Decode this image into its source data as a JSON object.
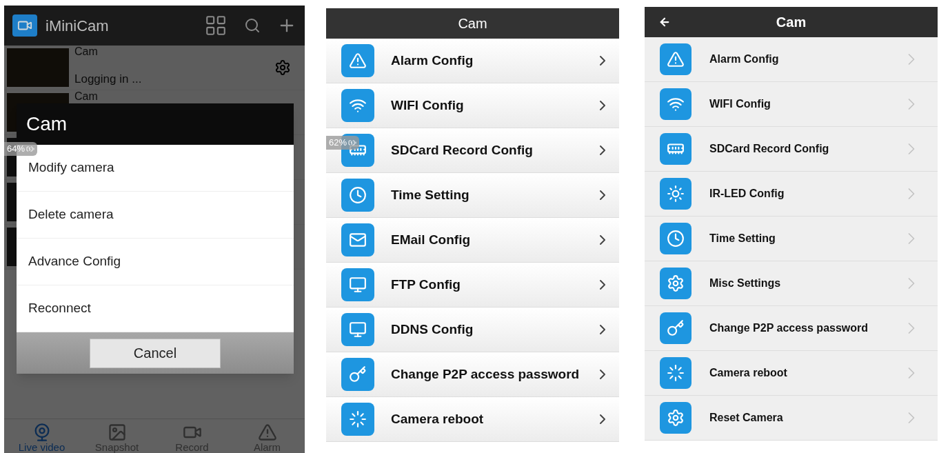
{
  "home_screen": {
    "app_title": "iMiniCam",
    "cameras": [
      {
        "name": "Cam",
        "status": "Logging in ..."
      },
      {
        "name": "Cam"
      },
      {
        "kind": "thumbnail_only"
      },
      {
        "kind": "thumbnail_only"
      },
      {
        "kind": "thumbnail_only"
      }
    ],
    "battery": "64%",
    "dialog": {
      "title": "Cam",
      "options": [
        "Modify camera",
        "Delete camera",
        "Advance Config",
        "Reconnect"
      ],
      "cancel": "Cancel"
    },
    "bottom_nav": [
      {
        "label": "Live video",
        "kind": "live",
        "selected": true
      },
      {
        "label": "Snapshot",
        "kind": "snapshot",
        "selected": false
      },
      {
        "label": "Record",
        "kind": "record",
        "selected": false
      },
      {
        "label": "Alarm",
        "kind": "alarm",
        "selected": false
      }
    ]
  },
  "settings_screen": {
    "title": "Cam",
    "back": false,
    "battery": "62%",
    "items": [
      {
        "label": "Alarm Config",
        "kind": "alarm"
      },
      {
        "label": "WIFI Config",
        "kind": "wifi"
      },
      {
        "label": "SDCard Record Config",
        "kind": "sdcard"
      },
      {
        "label": "Time Setting",
        "kind": "clock"
      },
      {
        "label": "EMail Config",
        "kind": "mail"
      },
      {
        "label": "FTP Config",
        "kind": "ftp"
      },
      {
        "label": "DDNS Config",
        "kind": "ddns"
      },
      {
        "label": "Change P2P access password",
        "kind": "key"
      },
      {
        "label": "Camera reboot",
        "kind": "reboot"
      }
    ]
  },
  "settings_screen_alt": {
    "title": "Cam",
    "back": true,
    "items": [
      {
        "label": "Alarm Config",
        "kind": "alarm"
      },
      {
        "label": "WIFI Config",
        "kind": "wifi"
      },
      {
        "label": "SDCard Record Config",
        "kind": "sdcard"
      },
      {
        "label": "IR-LED Config",
        "kind": "ir"
      },
      {
        "label": "Time Setting",
        "kind": "clock"
      },
      {
        "label": "Misc Settings",
        "kind": "gear"
      },
      {
        "label": "Change P2P access password",
        "kind": "key"
      },
      {
        "label": "Camera reboot",
        "kind": "reboot"
      },
      {
        "label": "Reset Camera",
        "kind": "gear"
      }
    ]
  }
}
